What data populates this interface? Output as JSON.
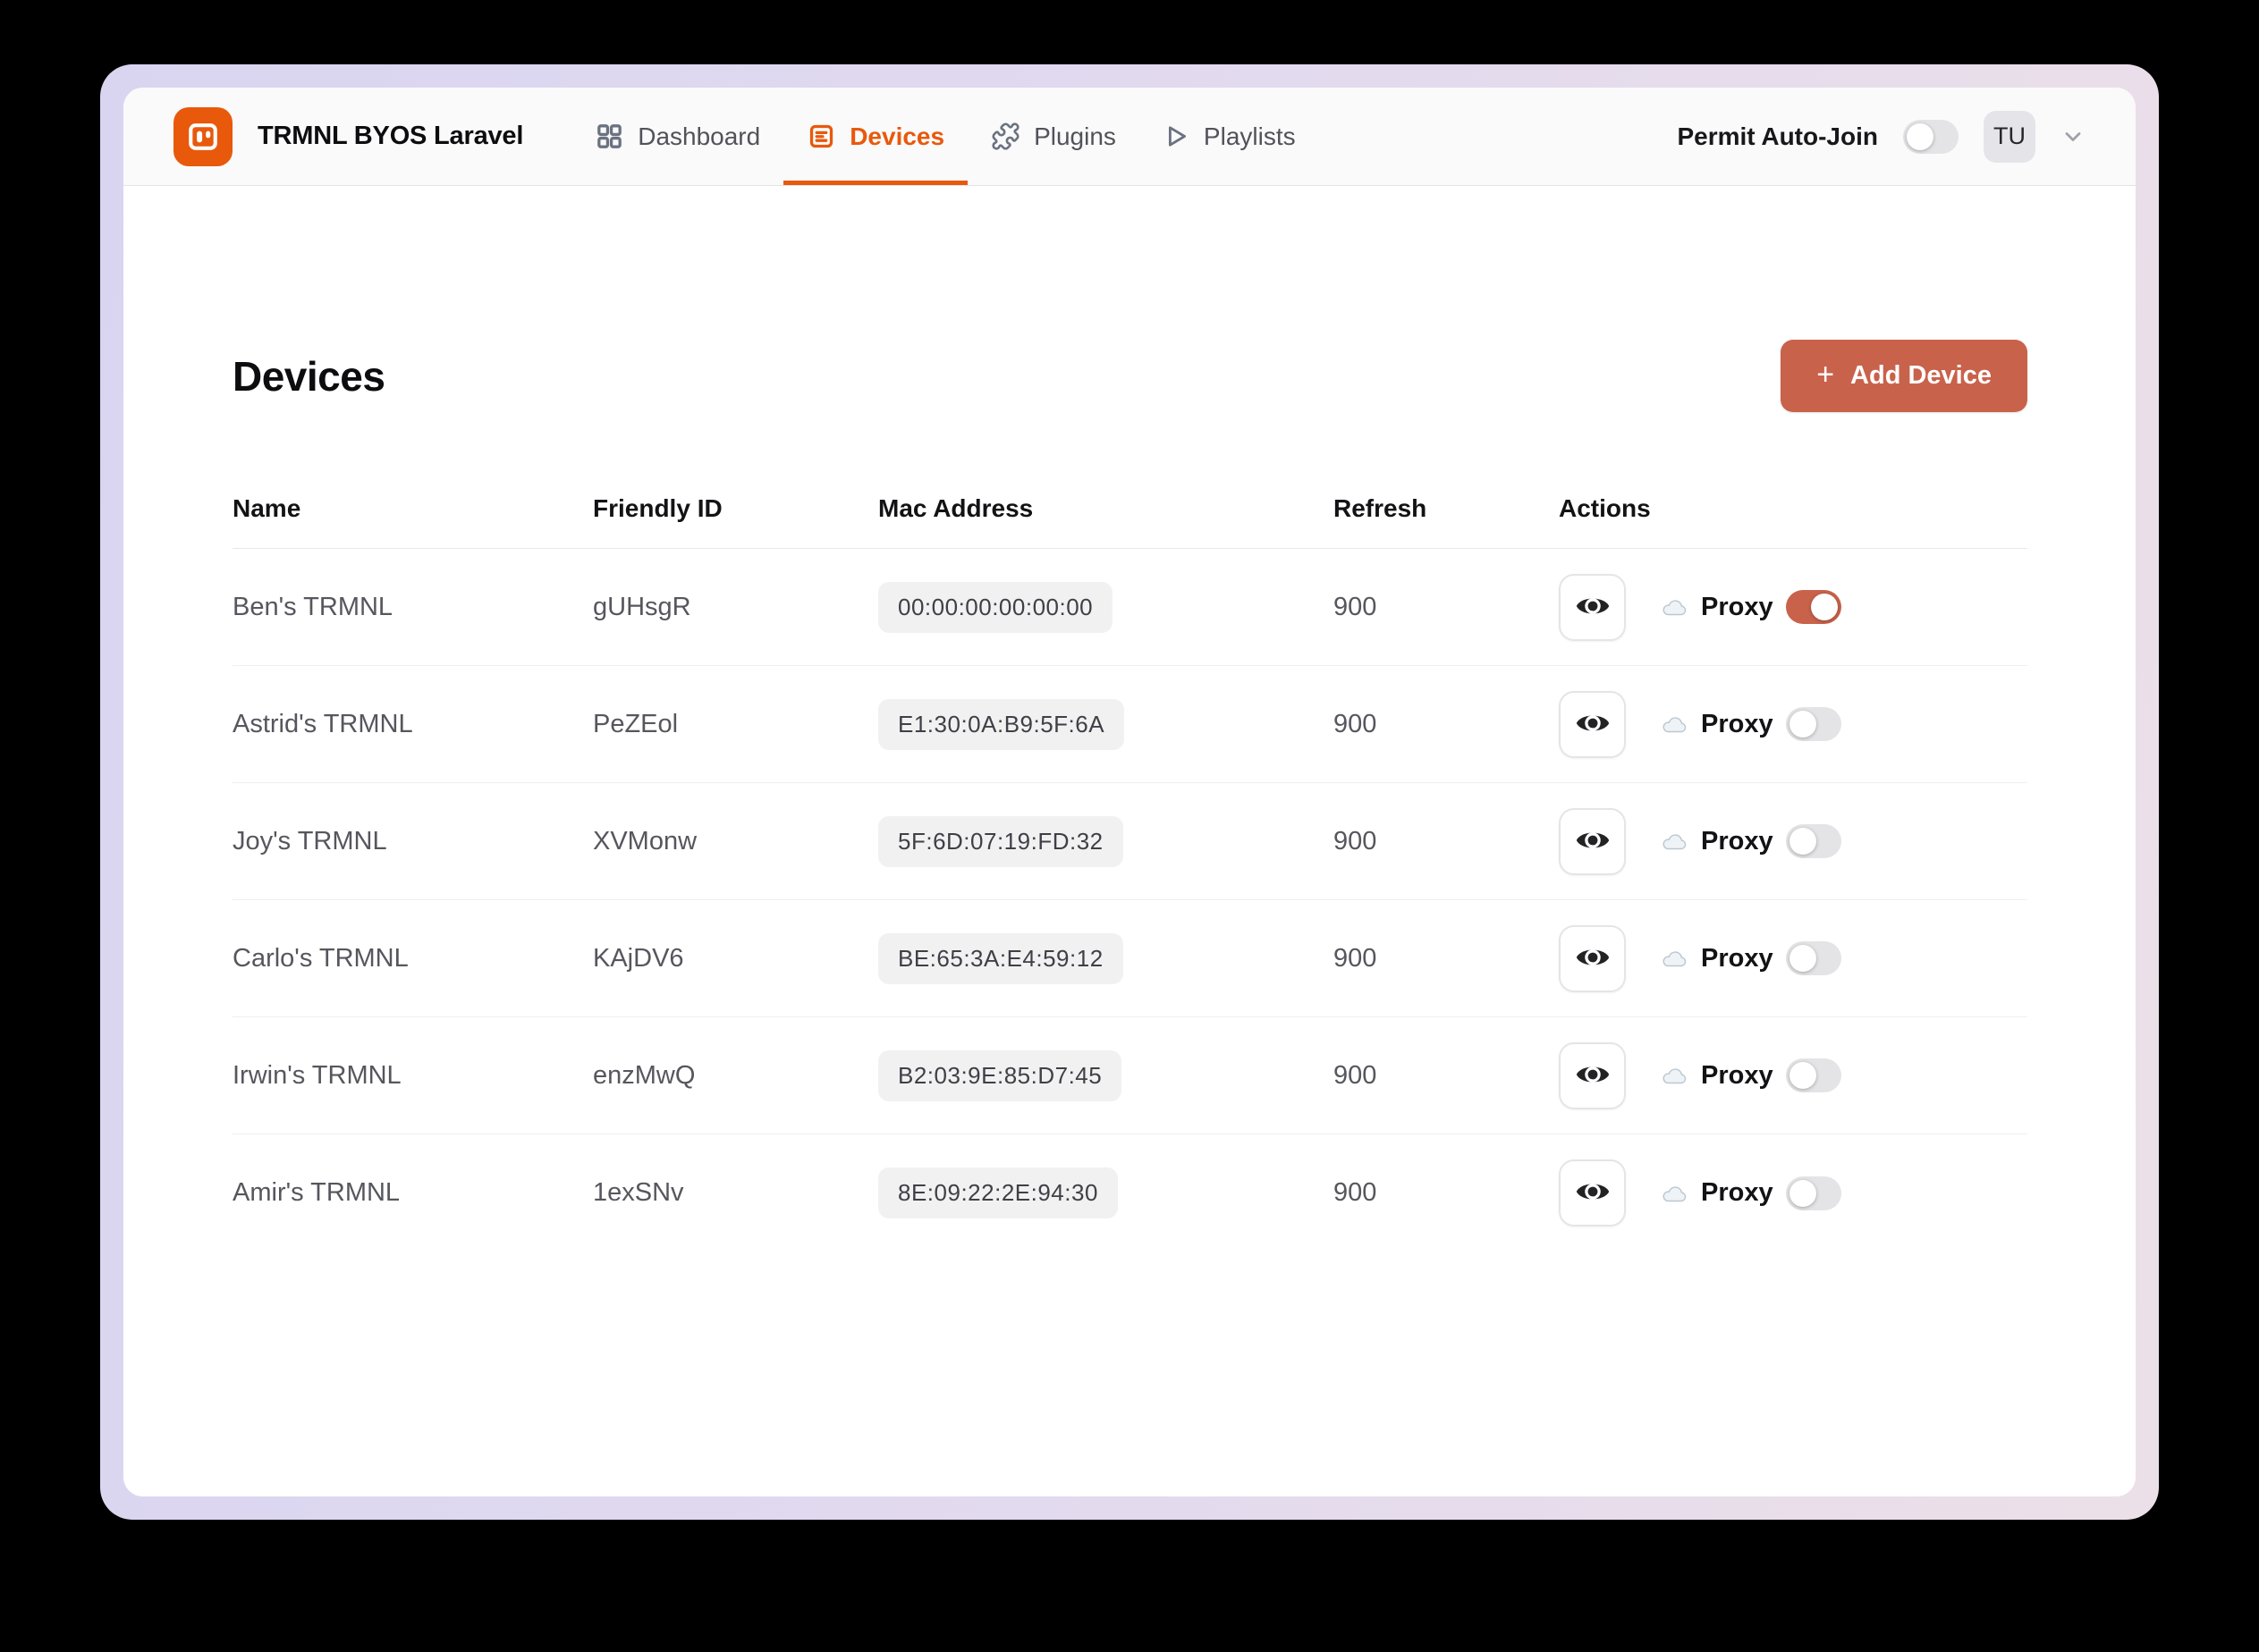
{
  "header": {
    "app_title": "TRMNL BYOS Laravel",
    "nav": [
      {
        "label": "Dashboard",
        "icon": "grid-icon",
        "active": false
      },
      {
        "label": "Devices",
        "icon": "device-list-icon",
        "active": true
      },
      {
        "label": "Plugins",
        "icon": "puzzle-icon",
        "active": false
      },
      {
        "label": "Playlists",
        "icon": "play-icon",
        "active": false
      }
    ],
    "permit_auto_join": {
      "label": "Permit Auto-Join",
      "enabled": false
    },
    "avatar_initials": "TU"
  },
  "page": {
    "title": "Devices",
    "add_device_button": {
      "plus": "+",
      "label": "Add Device"
    }
  },
  "table": {
    "columns": [
      "Name",
      "Friendly ID",
      "Mac Address",
      "Refresh",
      "Actions"
    ],
    "proxy_label": "Proxy",
    "rows": [
      {
        "name": "Ben's TRMNL",
        "friendly_id": "gUHsgR",
        "mac": "00:00:00:00:00:00",
        "refresh": "900",
        "proxy": true
      },
      {
        "name": "Astrid's TRMNL",
        "friendly_id": "PeZEol",
        "mac": "E1:30:0A:B9:5F:6A",
        "refresh": "900",
        "proxy": false
      },
      {
        "name": "Joy's TRMNL",
        "friendly_id": "XVMonw",
        "mac": "5F:6D:07:19:FD:32",
        "refresh": "900",
        "proxy": false
      },
      {
        "name": "Carlo's TRMNL",
        "friendly_id": "KAjDV6",
        "mac": "BE:65:3A:E4:59:12",
        "refresh": "900",
        "proxy": false
      },
      {
        "name": "Irwin's TRMNL",
        "friendly_id": "enzMwQ",
        "mac": "B2:03:9E:85:D7:45",
        "refresh": "900",
        "proxy": false
      },
      {
        "name": "Amir's TRMNL",
        "friendly_id": "1exSNv",
        "mac": "8E:09:22:2E:94:30",
        "refresh": "900",
        "proxy": false
      }
    ]
  },
  "colors": {
    "brand_orange": "#e8590c",
    "accent_terracotta": "#c9624b",
    "frame_gradient_left": "#d9d5f1",
    "frame_gradient_right": "#ece0e8",
    "header_bg": "#fafafa",
    "chip_bg": "#f1f1f2",
    "row_border": "#efeff1",
    "text_dark": "#0d0d0f",
    "text_gray": "#56565e"
  }
}
